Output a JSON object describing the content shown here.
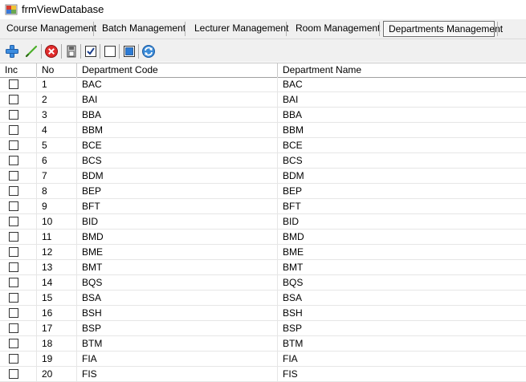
{
  "window": {
    "title": "frmViewDatabase"
  },
  "tabs": [
    {
      "label": "Course Management"
    },
    {
      "label": "Batch Management"
    },
    {
      "label": "Lecturer Management"
    },
    {
      "label": "Room Management"
    },
    {
      "label": "Departments Management",
      "active": true
    }
  ],
  "toolbar": {
    "icons": [
      "add-icon",
      "edit-icon",
      "delete-icon",
      "save-icon",
      "check-all-icon",
      "uncheck-all-icon",
      "preview-icon",
      "refresh-icon"
    ]
  },
  "grid": {
    "columns": [
      "Inc",
      "No",
      "Department Code",
      "Department Name"
    ],
    "rows": [
      {
        "no": "1",
        "code": "BAC",
        "name": "BAC"
      },
      {
        "no": "2",
        "code": "BAI",
        "name": "BAI"
      },
      {
        "no": "3",
        "code": "BBA",
        "name": "BBA"
      },
      {
        "no": "4",
        "code": "BBM",
        "name": "BBM"
      },
      {
        "no": "5",
        "code": "BCE",
        "name": "BCE"
      },
      {
        "no": "6",
        "code": "BCS",
        "name": "BCS"
      },
      {
        "no": "7",
        "code": "BDM",
        "name": "BDM"
      },
      {
        "no": "8",
        "code": "BEP",
        "name": "BEP"
      },
      {
        "no": "9",
        "code": "BFT",
        "name": "BFT"
      },
      {
        "no": "10",
        "code": "BID",
        "name": "BID"
      },
      {
        "no": "11",
        "code": "BMD",
        "name": "BMD"
      },
      {
        "no": "12",
        "code": "BME",
        "name": "BME"
      },
      {
        "no": "13",
        "code": "BMT",
        "name": "BMT"
      },
      {
        "no": "14",
        "code": "BQS",
        "name": "BQS"
      },
      {
        "no": "15",
        "code": "BSA",
        "name": "BSA"
      },
      {
        "no": "16",
        "code": "BSH",
        "name": "BSH"
      },
      {
        "no": "17",
        "code": "BSP",
        "name": "BSP"
      },
      {
        "no": "18",
        "code": "BTM",
        "name": "BTM"
      },
      {
        "no": "19",
        "code": "FIA",
        "name": "FIA"
      },
      {
        "no": "20",
        "code": "FIS",
        "name": "FIS"
      }
    ]
  }
}
